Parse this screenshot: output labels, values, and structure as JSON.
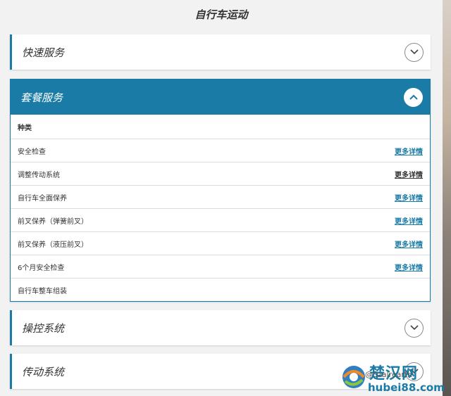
{
  "page": {
    "title": "自行车运动"
  },
  "panels": [
    {
      "title": "快速服务",
      "open": false
    },
    {
      "title": "套餐服务",
      "open": true
    },
    {
      "title": "操控系统",
      "open": false
    },
    {
      "title": "传动系统",
      "open": false
    }
  ],
  "package_table": {
    "header": "种类",
    "rows": [
      {
        "name": "安全检查",
        "link": "更多详情"
      },
      {
        "name": "调整传动系统",
        "link": "更多详情"
      },
      {
        "name": "自行车全面保养",
        "link": "更多详情"
      },
      {
        "name": "前叉保养（弹簧前叉）",
        "link": "更多详情"
      },
      {
        "name": "前叉保养（液压前叉）",
        "link": "更多详情"
      },
      {
        "name": "6个月安全检查",
        "link": "更多详情"
      },
      {
        "name": "自行车整车组装",
        "link": ""
      }
    ]
  },
  "watermark": {
    "brand": "楚汉网",
    "domain": "hubei88.com",
    "overlay_text": "@Szalrearth"
  },
  "colors": {
    "accent": "#1a7ba6",
    "background": "#f2f2f2"
  },
  "icons": {
    "chevron_down": "chevron-down-icon",
    "chevron_up": "chevron-up-icon"
  }
}
